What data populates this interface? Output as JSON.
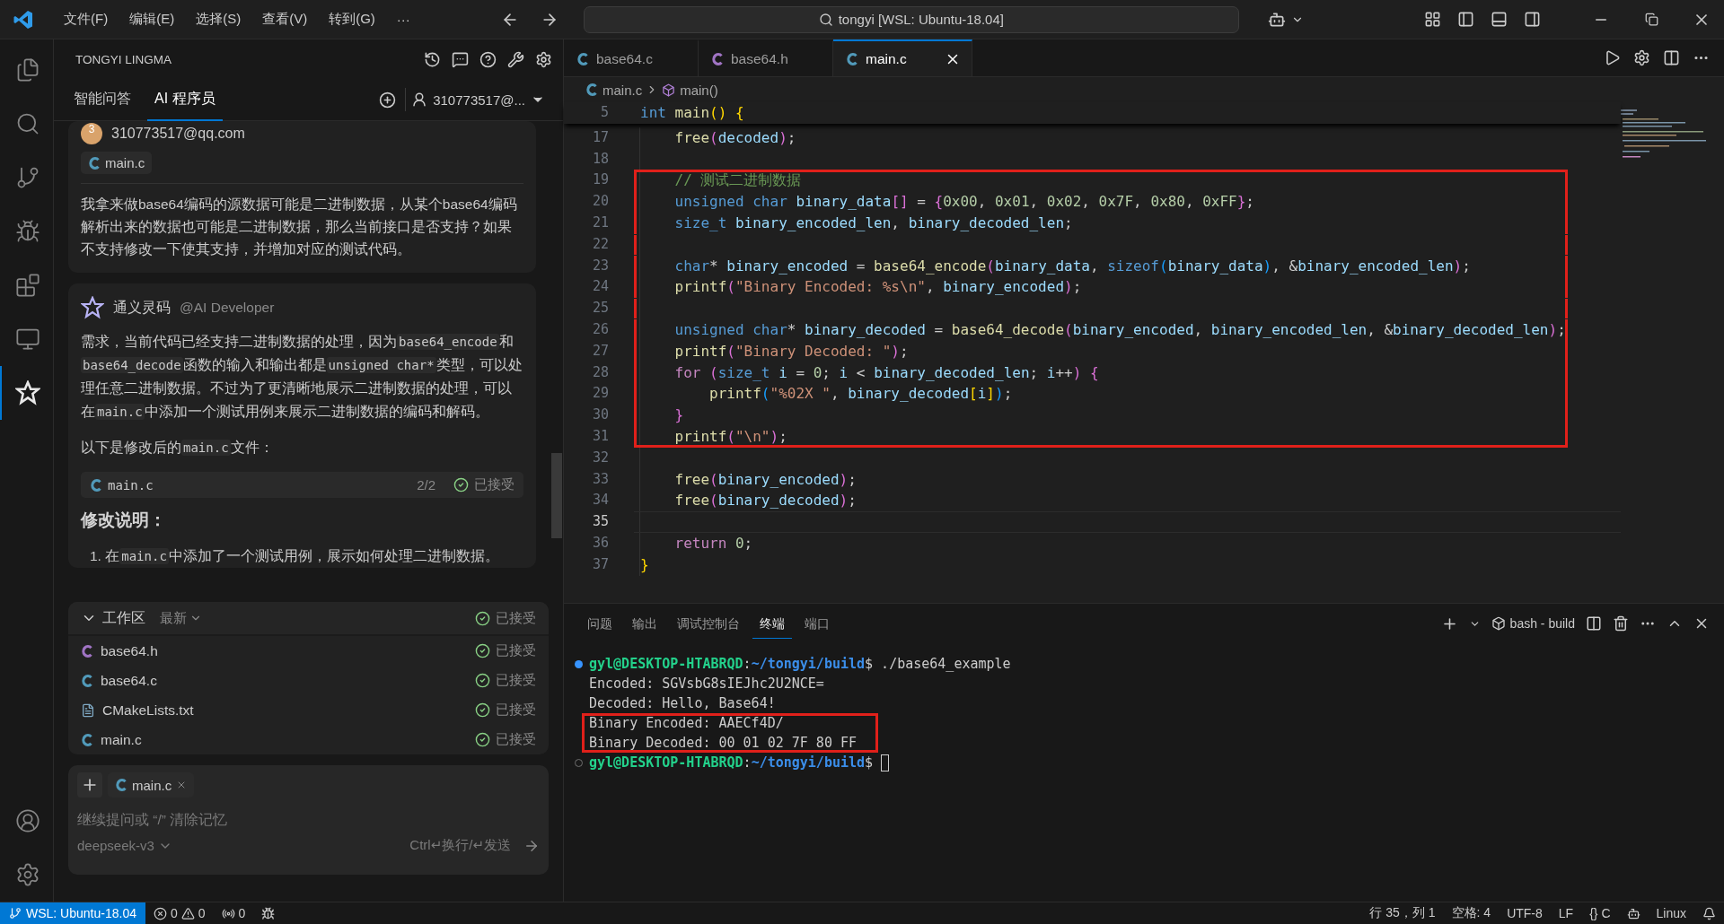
{
  "title_bar": {
    "menus": [
      "文件(F)",
      "编辑(E)",
      "选择(S)",
      "查看(V)",
      "转到(G)"
    ],
    "more": "···",
    "search": "tongyi [WSL: Ubuntu-18.04]"
  },
  "activity_bar": {
    "items": [
      {
        "selected": false
      },
      {
        "selected": false
      },
      {
        "selected": false
      },
      {
        "selected": false
      },
      {
        "selected": false
      },
      {
        "selected": false
      },
      {
        "selected": true
      }
    ]
  },
  "side_panel": {
    "title": "TONGYI LINGMA",
    "tabs": [
      {
        "label": "智能问答",
        "selected": false
      },
      {
        "label": "AI 程序员",
        "selected": true
      }
    ],
    "account": "310773517@...",
    "chat": [
      {
        "kind": "user",
        "avatar": "3",
        "name": "310773517@qq.com",
        "file": "main.c",
        "text": "我拿来做base64编码的源数据可能是二进制数据，从某个base64编码解析出来的数据也可能是二进制数据，那么当前接口是否支持？如果不支持修改一下使其支持，并增加对应的测试代码。"
      },
      {
        "kind": "ai",
        "name": "通义灵码",
        "role": "@AI Developer",
        "blocks": [
          {
            "kind": "paragraph",
            "segments": [
              {
                "kind": "text",
                "text": "需求，当前代码已经支持二进制数据的处理，因为"
              },
              {
                "kind": "code",
                "text": "base64_encode"
              },
              {
                "kind": "text",
                "text": "和"
              },
              {
                "kind": "code",
                "text": "base64_decode"
              },
              {
                "kind": "text",
                "text": "函数的输入和输出都是"
              },
              {
                "kind": "code",
                "text": "unsigned char*"
              },
              {
                "kind": "text",
                "text": "类型，可以处理任意二进制数据。不过为了更清晰地展示二进制数据的处理，可以在"
              },
              {
                "kind": "code",
                "text": "main.c"
              },
              {
                "kind": "text",
                "text": "中添加一个测试用例来展示二进制数据的编码和解码。"
              }
            ]
          },
          {
            "kind": "paragraph",
            "segments": [
              {
                "kind": "text",
                "text": "以下是修改后的"
              },
              {
                "kind": "code",
                "text": "main.c"
              },
              {
                "kind": "text",
                "text": "文件："
              }
            ]
          },
          {
            "kind": "file",
            "name": "main.c",
            "count": "2/2",
            "status": "已接受"
          },
          {
            "kind": "heading",
            "text": "修改说明："
          },
          {
            "kind": "list_item",
            "number": "1.",
            "segments": [
              {
                "kind": "text",
                "text": "在"
              },
              {
                "kind": "code",
                "text": "main.c"
              },
              {
                "kind": "text",
                "text": "中添加了一个测试用例，展示如何处理二进制数据。"
              }
            ]
          }
        ]
      }
    ],
    "workspace": {
      "title": "工作区",
      "sort": "最新",
      "status": "已接受",
      "expanded": true,
      "files": [
        {
          "name": "base64.h",
          "kind": "header",
          "status": "已接受"
        },
        {
          "name": "base64.c",
          "kind": "source",
          "status": "已接受"
        },
        {
          "name": "CMakeLists.txt",
          "kind": "text",
          "status": "已接受"
        },
        {
          "name": "main.c",
          "kind": "source",
          "status": "已接受"
        }
      ]
    },
    "input": {
      "chip": "main.c",
      "placeholder": "继续提问或 “/” 清除记忆",
      "model": "deepseek-v3",
      "hint": "Ctrl↵换行/↵发送"
    }
  },
  "editor": {
    "tabs": [
      {
        "label": "base64.c",
        "kind": "source",
        "selected": false
      },
      {
        "label": "base64.h",
        "kind": "header",
        "selected": false
      },
      {
        "label": "main.c",
        "kind": "source",
        "selected": true
      }
    ],
    "breadcrumb": [
      "main.c",
      "main()"
    ],
    "sticky": {
      "number": "5",
      "tokens": [
        {
          "kind": "kw",
          "text": "int "
        },
        {
          "kind": "fn",
          "text": "main"
        },
        {
          "kind": "b1",
          "text": "()"
        },
        {
          "kind": "b1",
          "text": " {"
        }
      ]
    },
    "lines": [
      {
        "number": "17",
        "current": false,
        "boxed": false,
        "tokens": [
          {
            "kind": "fn",
            "text": "    free"
          },
          {
            "kind": "b2",
            "text": "("
          },
          {
            "kind": "var",
            "text": "decoded"
          },
          {
            "kind": "b2",
            "text": ")"
          },
          {
            "kind": "txt",
            "text": ";"
          }
        ]
      },
      {
        "number": "18",
        "current": false,
        "boxed": false
      },
      {
        "number": "19",
        "current": false,
        "boxed": true,
        "tokens": [
          {
            "kind": "cmt",
            "text": "    // 测试二进制数据"
          }
        ]
      },
      {
        "number": "20",
        "current": false,
        "boxed": true,
        "tokens": [
          {
            "kind": "kw",
            "text": "    unsigned "
          },
          {
            "kind": "kw",
            "text": "char "
          },
          {
            "kind": "var",
            "text": "binary_data"
          },
          {
            "kind": "b2",
            "text": "[]"
          },
          {
            "kind": "txt",
            "text": " = "
          },
          {
            "kind": "b2",
            "text": "{"
          },
          {
            "kind": "num",
            "text": "0x00"
          },
          {
            "kind": "txt",
            "text": ", "
          },
          {
            "kind": "num",
            "text": "0x01"
          },
          {
            "kind": "txt",
            "text": ", "
          },
          {
            "kind": "num",
            "text": "0x02"
          },
          {
            "kind": "txt",
            "text": ", "
          },
          {
            "kind": "num",
            "text": "0x7F"
          },
          {
            "kind": "txt",
            "text": ", "
          },
          {
            "kind": "num",
            "text": "0x80"
          },
          {
            "kind": "txt",
            "text": ", "
          },
          {
            "kind": "num",
            "text": "0xFF"
          },
          {
            "kind": "b2",
            "text": "}"
          },
          {
            "kind": "txt",
            "text": ";"
          }
        ]
      },
      {
        "number": "21",
        "current": false,
        "boxed": true,
        "tokens": [
          {
            "kind": "kw",
            "text": "    size_t "
          },
          {
            "kind": "var",
            "text": "binary_encoded_len"
          },
          {
            "kind": "txt",
            "text": ", "
          },
          {
            "kind": "var",
            "text": "binary_decoded_len"
          },
          {
            "kind": "txt",
            "text": ";"
          }
        ]
      },
      {
        "number": "22",
        "current": false,
        "boxed": true
      },
      {
        "number": "23",
        "current": false,
        "boxed": true,
        "tokens": [
          {
            "kind": "kw",
            "text": "    char"
          },
          {
            "kind": "txt",
            "text": "* "
          },
          {
            "kind": "var",
            "text": "binary_encoded"
          },
          {
            "kind": "txt",
            "text": " = "
          },
          {
            "kind": "fn",
            "text": "base64_encode"
          },
          {
            "kind": "b2",
            "text": "("
          },
          {
            "kind": "var",
            "text": "binary_data"
          },
          {
            "kind": "txt",
            "text": ", "
          },
          {
            "kind": "kw",
            "text": "sizeof"
          },
          {
            "kind": "b3",
            "text": "("
          },
          {
            "kind": "var",
            "text": "binary_data"
          },
          {
            "kind": "b3",
            "text": ")"
          },
          {
            "kind": "txt",
            "text": ", &"
          },
          {
            "kind": "var",
            "text": "binary_encoded_len"
          },
          {
            "kind": "b2",
            "text": ")"
          },
          {
            "kind": "txt",
            "text": ";"
          }
        ]
      },
      {
        "number": "24",
        "current": false,
        "boxed": true,
        "tokens": [
          {
            "kind": "fn",
            "text": "    printf"
          },
          {
            "kind": "b2",
            "text": "("
          },
          {
            "kind": "str",
            "text": "\"Binary Encoded: %s\\n\""
          },
          {
            "kind": "txt",
            "text": ", "
          },
          {
            "kind": "var",
            "text": "binary_encoded"
          },
          {
            "kind": "b2",
            "text": ")"
          },
          {
            "kind": "txt",
            "text": ";"
          }
        ]
      },
      {
        "number": "25",
        "current": false,
        "boxed": true
      },
      {
        "number": "26",
        "current": false,
        "boxed": true,
        "tokens": [
          {
            "kind": "kw",
            "text": "    unsigned "
          },
          {
            "kind": "kw",
            "text": "char"
          },
          {
            "kind": "txt",
            "text": "* "
          },
          {
            "kind": "var",
            "text": "binary_decoded"
          },
          {
            "kind": "txt",
            "text": " = "
          },
          {
            "kind": "fn",
            "text": "base64_decode"
          },
          {
            "kind": "b2",
            "text": "("
          },
          {
            "kind": "var",
            "text": "binary_encoded"
          },
          {
            "kind": "txt",
            "text": ", "
          },
          {
            "kind": "var",
            "text": "binary_encoded_len"
          },
          {
            "kind": "txt",
            "text": ", &"
          },
          {
            "kind": "var",
            "text": "binary_decoded_len"
          },
          {
            "kind": "b2",
            "text": ")"
          },
          {
            "kind": "txt",
            "text": ";"
          }
        ]
      },
      {
        "number": "27",
        "current": false,
        "boxed": true,
        "tokens": [
          {
            "kind": "fn",
            "text": "    printf"
          },
          {
            "kind": "b2",
            "text": "("
          },
          {
            "kind": "str",
            "text": "\"Binary Decoded: \""
          },
          {
            "kind": "b2",
            "text": ")"
          },
          {
            "kind": "txt",
            "text": ";"
          }
        ]
      },
      {
        "number": "28",
        "current": false,
        "boxed": true,
        "tokens": [
          {
            "kind": "ctl",
            "text": "    for "
          },
          {
            "kind": "b2",
            "text": "("
          },
          {
            "kind": "kw",
            "text": "size_t "
          },
          {
            "kind": "var",
            "text": "i"
          },
          {
            "kind": "txt",
            "text": " = "
          },
          {
            "kind": "num",
            "text": "0"
          },
          {
            "kind": "txt",
            "text": "; "
          },
          {
            "kind": "var",
            "text": "i"
          },
          {
            "kind": "txt",
            "text": " < "
          },
          {
            "kind": "var",
            "text": "binary_decoded_len"
          },
          {
            "kind": "txt",
            "text": "; "
          },
          {
            "kind": "var",
            "text": "i"
          },
          {
            "kind": "txt",
            "text": "++"
          },
          {
            "kind": "b2",
            "text": ")"
          },
          {
            "kind": "b2",
            "text": " {"
          }
        ]
      },
      {
        "number": "29",
        "current": false,
        "boxed": true,
        "tokens": [
          {
            "kind": "fn",
            "text": "        printf"
          },
          {
            "kind": "b3",
            "text": "("
          },
          {
            "kind": "str",
            "text": "\"%02X \""
          },
          {
            "kind": "txt",
            "text": ", "
          },
          {
            "kind": "var",
            "text": "binary_decoded"
          },
          {
            "kind": "b1",
            "text": "["
          },
          {
            "kind": "var",
            "text": "i"
          },
          {
            "kind": "b1",
            "text": "]"
          },
          {
            "kind": "b3",
            "text": ")"
          },
          {
            "kind": "txt",
            "text": ";"
          }
        ]
      },
      {
        "number": "30",
        "current": false,
        "boxed": true,
        "tokens": [
          {
            "kind": "b2",
            "text": "    }"
          }
        ]
      },
      {
        "number": "31",
        "current": false,
        "boxed": true,
        "tokens": [
          {
            "kind": "fn",
            "text": "    printf"
          },
          {
            "kind": "b2",
            "text": "("
          },
          {
            "kind": "str",
            "text": "\"\\n\""
          },
          {
            "kind": "b2",
            "text": ")"
          },
          {
            "kind": "txt",
            "text": ";"
          }
        ]
      },
      {
        "number": "32",
        "current": false,
        "boxed": false
      },
      {
        "number": "33",
        "current": false,
        "boxed": false,
        "tokens": [
          {
            "kind": "fn",
            "text": "    free"
          },
          {
            "kind": "b2",
            "text": "("
          },
          {
            "kind": "var",
            "text": "binary_encoded"
          },
          {
            "kind": "b2",
            "text": ")"
          },
          {
            "kind": "txt",
            "text": ";"
          }
        ]
      },
      {
        "number": "34",
        "current": false,
        "boxed": false,
        "tokens": [
          {
            "kind": "fn",
            "text": "    free"
          },
          {
            "kind": "b2",
            "text": "("
          },
          {
            "kind": "var",
            "text": "binary_decoded"
          },
          {
            "kind": "b2",
            "text": ")"
          },
          {
            "kind": "txt",
            "text": ";"
          }
        ]
      },
      {
        "number": "35",
        "current": true,
        "boxed": false
      },
      {
        "number": "36",
        "current": false,
        "boxed": false,
        "tokens": [
          {
            "kind": "ctl",
            "text": "    return "
          },
          {
            "kind": "num",
            "text": "0"
          },
          {
            "kind": "txt",
            "text": ";"
          }
        ]
      },
      {
        "number": "37",
        "current": false,
        "boxed": false,
        "tokens": [
          {
            "kind": "b1",
            "text": "}"
          }
        ]
      }
    ]
  },
  "panel": {
    "tabs": [
      {
        "label": "问题",
        "selected": false
      },
      {
        "label": "输出",
        "selected": false
      },
      {
        "label": "调试控制台",
        "selected": false
      },
      {
        "label": "终端",
        "selected": true
      },
      {
        "label": "端口",
        "selected": false
      }
    ],
    "terminal_name": "bash - build",
    "lines": [
      {
        "kind": "command",
        "boxed": false,
        "segments": [
          {
            "kind": "user",
            "text": "gyl@DESKTOP-HTABRQD"
          },
          {
            "kind": "plain",
            "text": ":"
          },
          {
            "kind": "path",
            "text": "~/tongyi/build"
          },
          {
            "kind": "plain",
            "text": "$ ./base64_example"
          }
        ]
      },
      {
        "kind": "output",
        "boxed": false,
        "segments": [
          {
            "kind": "plain",
            "text": "Encoded: SGVsbG8sIEJhc2U2NCE="
          }
        ]
      },
      {
        "kind": "output",
        "boxed": false,
        "segments": [
          {
            "kind": "plain",
            "text": "Decoded: Hello, Base64!"
          }
        ]
      },
      {
        "kind": "output",
        "boxed": true,
        "segments": [
          {
            "kind": "plain",
            "text": "Binary Encoded: AAECf4D/"
          }
        ]
      },
      {
        "kind": "output",
        "boxed": true,
        "segments": [
          {
            "kind": "plain",
            "text": "Binary Decoded: 00 01 02 7F 80 FF"
          }
        ]
      },
      {
        "kind": "prompt",
        "boxed": false,
        "segments": [
          {
            "kind": "user",
            "text": "gyl@DESKTOP-HTABRQD"
          },
          {
            "kind": "plain",
            "text": ":"
          },
          {
            "kind": "path",
            "text": "~/tongyi/build"
          },
          {
            "kind": "plain",
            "text": "$"
          }
        ]
      }
    ]
  },
  "status_bar": {
    "remote": "WSL: Ubuntu-18.04",
    "errors": "0",
    "warnings": "0",
    "ports": "0",
    "right": [
      "行 35，列 1",
      "空格: 4",
      "UTF-8",
      "LF",
      "{} C"
    ],
    "os": "Linux"
  }
}
